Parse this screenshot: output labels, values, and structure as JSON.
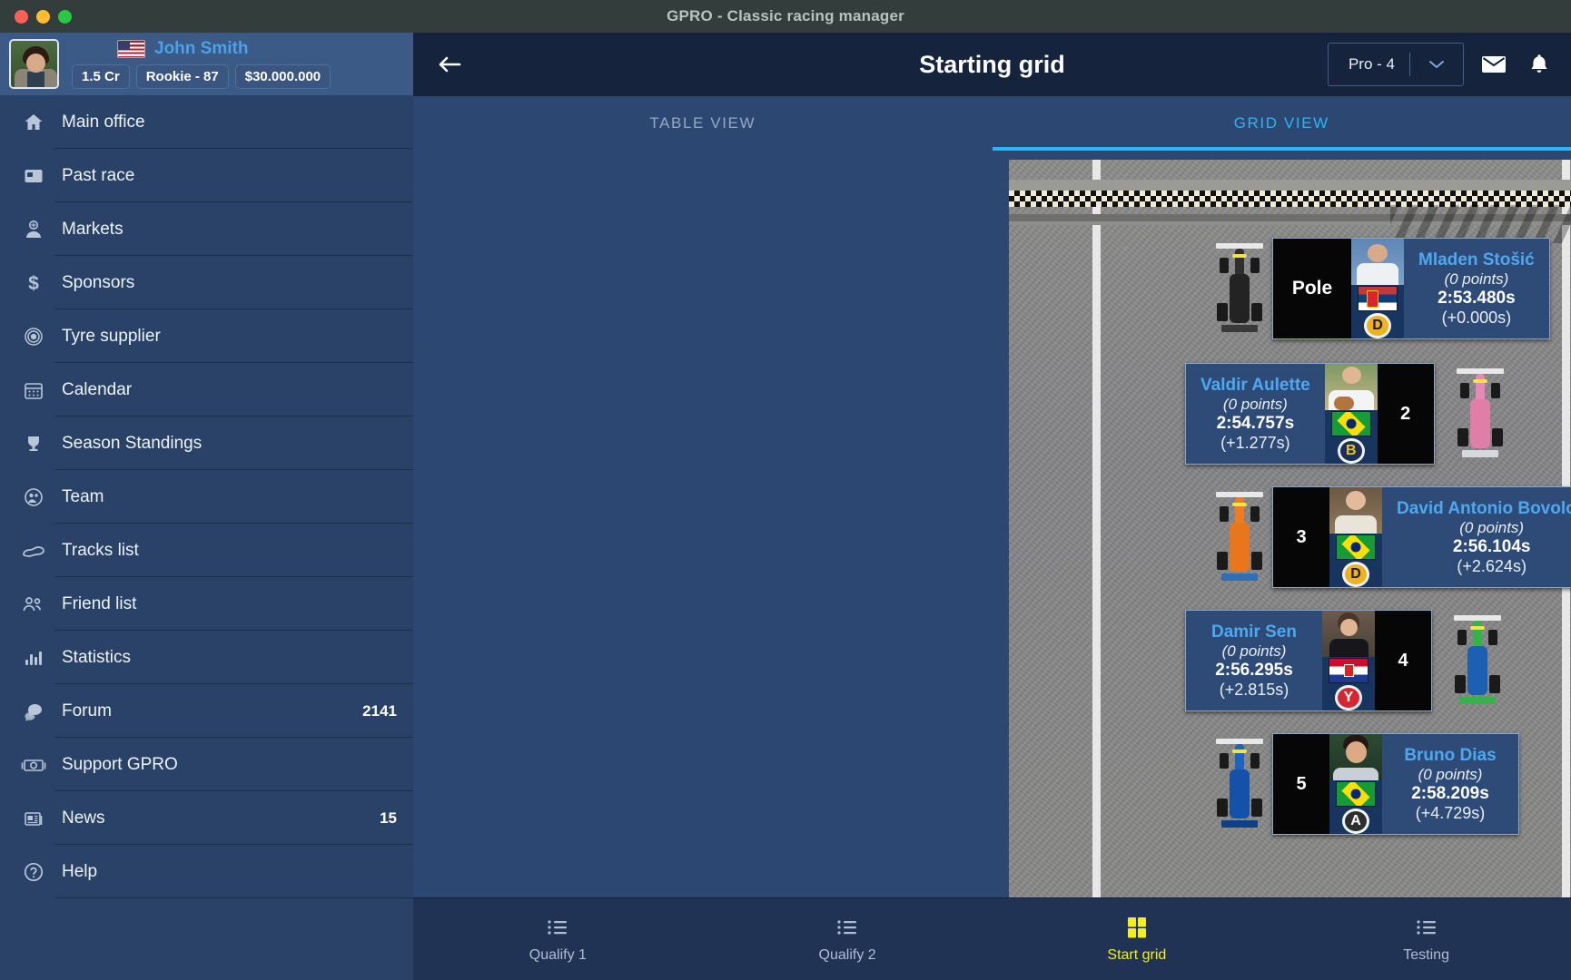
{
  "window": {
    "title": "GPRO - Classic racing manager"
  },
  "profile": {
    "name": "John Smith",
    "country_flag": "flag-united-states",
    "chips": [
      "1.5 Cr",
      "Rookie - 87",
      "$30.000.000"
    ]
  },
  "sidebar": {
    "items": [
      {
        "label": "Main office",
        "icon": "home-icon",
        "count": ""
      },
      {
        "label": "Past race",
        "icon": "past-race-icon",
        "count": ""
      },
      {
        "label": "Markets",
        "icon": "markets-icon",
        "count": ""
      },
      {
        "label": "Sponsors",
        "icon": "dollar-icon",
        "count": ""
      },
      {
        "label": "Tyre supplier",
        "icon": "tyre-icon",
        "count": ""
      },
      {
        "label": "Calendar",
        "icon": "calendar-icon",
        "count": ""
      },
      {
        "label": "Season Standings",
        "icon": "trophy-icon",
        "count": ""
      },
      {
        "label": "Team",
        "icon": "team-icon",
        "count": ""
      },
      {
        "label": "Tracks list",
        "icon": "track-icon",
        "count": ""
      },
      {
        "label": "Friend list",
        "icon": "friends-icon",
        "count": ""
      },
      {
        "label": "Statistics",
        "icon": "bar-chart-icon",
        "count": ""
      },
      {
        "label": "Forum",
        "icon": "chat-icon",
        "count": "2141"
      },
      {
        "label": "Support GPRO",
        "icon": "money-icon",
        "count": ""
      },
      {
        "label": "News",
        "icon": "news-icon",
        "count": "15"
      },
      {
        "label": "Help",
        "icon": "help-icon",
        "count": ""
      }
    ]
  },
  "header": {
    "back_icon": "back-arrow-icon",
    "title": "Starting grid",
    "league": "Pro - 4",
    "caret_icon": "chevron-down-icon",
    "mail_icon": "mail-icon",
    "bell_icon": "bell-icon"
  },
  "tabs": [
    {
      "label": "TABLE VIEW",
      "active": false
    },
    {
      "label": "GRID VIEW",
      "active": true
    }
  ],
  "grid": {
    "drivers": [
      {
        "position": "Pole",
        "side": "right",
        "name": "Mladen Stošić",
        "points": "(0 points)",
        "time": "2:53.480s",
        "gap": "(+0.000s)",
        "flag": "flag-serbia",
        "tyre": "D",
        "tyre_color": "#f0b21b",
        "car_color": "#2a2a2a",
        "car_accent": "#4a4a4a"
      },
      {
        "position": "2",
        "side": "left",
        "name": "Valdir Aulette",
        "points": "(0 points)",
        "time": "2:54.757s",
        "gap": "(+1.277s)",
        "flag": "flag-brazil",
        "tyre": "B",
        "tyre_color": "#f0b21b",
        "car_color": "#e888b4",
        "car_accent": "#d7d7df"
      },
      {
        "position": "3",
        "side": "right",
        "name": "David Antonio Bovolon",
        "points": "(0 points)",
        "time": "2:56.104s",
        "gap": "(+2.624s)",
        "flag": "flag-brazil",
        "tyre": "D",
        "tyre_color": "#f0b21b",
        "car_color": "#ef7d1f",
        "car_accent": "#2f6fb5"
      },
      {
        "position": "4",
        "side": "left",
        "name": "Damir Sen",
        "points": "(0 points)",
        "time": "2:56.295s",
        "gap": "(+2.815s)",
        "flag": "flag-croatia",
        "tyre": "Y",
        "tyre_color": "#d7262d",
        "car_color": "#36b24a",
        "car_accent": "#1d5fb0"
      },
      {
        "position": "5",
        "side": "right",
        "name": "Bruno Dias",
        "points": "(0 points)",
        "time": "2:58.209s",
        "gap": "(+4.729s)",
        "flag": "flag-brazil",
        "tyre": "A",
        "tyre_color": "#2e2e2e",
        "car_color": "#1c63c4",
        "car_accent": "#0f3f86"
      }
    ]
  },
  "bottom_nav": [
    {
      "label": "Qualify 1",
      "icon": "list-icon",
      "active": false
    },
    {
      "label": "Qualify 2",
      "icon": "list-icon",
      "active": false
    },
    {
      "label": "Start grid",
      "icon": "grid-icon",
      "active": true
    },
    {
      "label": "Testing",
      "icon": "list-icon",
      "active": false
    }
  ],
  "colors": {
    "accent": "#29b6f6",
    "active_yellow": "#f5ee1d",
    "sidebar_bg": "#2a4268",
    "topbar_bg": "#16233c",
    "name_blue": "#4fa8ef"
  }
}
